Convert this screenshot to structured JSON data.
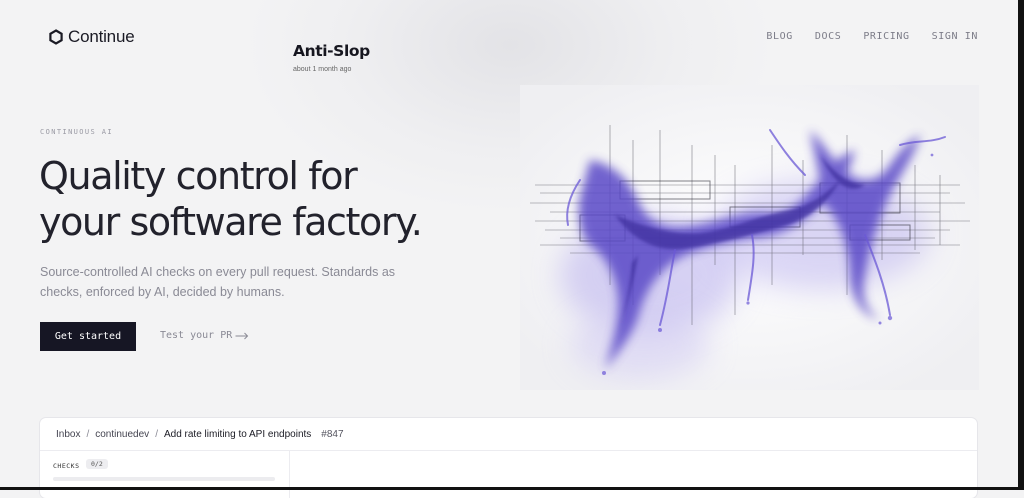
{
  "header": {
    "brand": "Continue",
    "nav": [
      {
        "label": "BLOG"
      },
      {
        "label": "DOCS"
      },
      {
        "label": "PRICING"
      },
      {
        "label": "SIGN IN"
      }
    ]
  },
  "hero": {
    "eyebrow": "CONTINUOUS AI",
    "headline_line1": "Quality control for",
    "headline_line2": "your software factory.",
    "subtext": "Source-controlled AI checks on every pull request. Standards as checks, enforced by AI, decided by humans.",
    "cta_primary": "Get started",
    "cta_secondary": "Test your PR",
    "cta_secondary_icon": "arrow-right-icon"
  },
  "colors": {
    "accent": "#6a56d9",
    "dark": "#161624",
    "background": "#f3f3f4"
  },
  "panel": {
    "breadcrumb": {
      "inbox": "Inbox",
      "sep": "/",
      "repo": "continuedev",
      "pr_title": "Add rate limiting to API endpoints",
      "pr_number": "#847"
    },
    "checks_label": "CHECKS",
    "checks_count": "0/2",
    "checks_progress": 0,
    "check_title": "Anti-Slop",
    "check_time": "about 1 month ago"
  }
}
